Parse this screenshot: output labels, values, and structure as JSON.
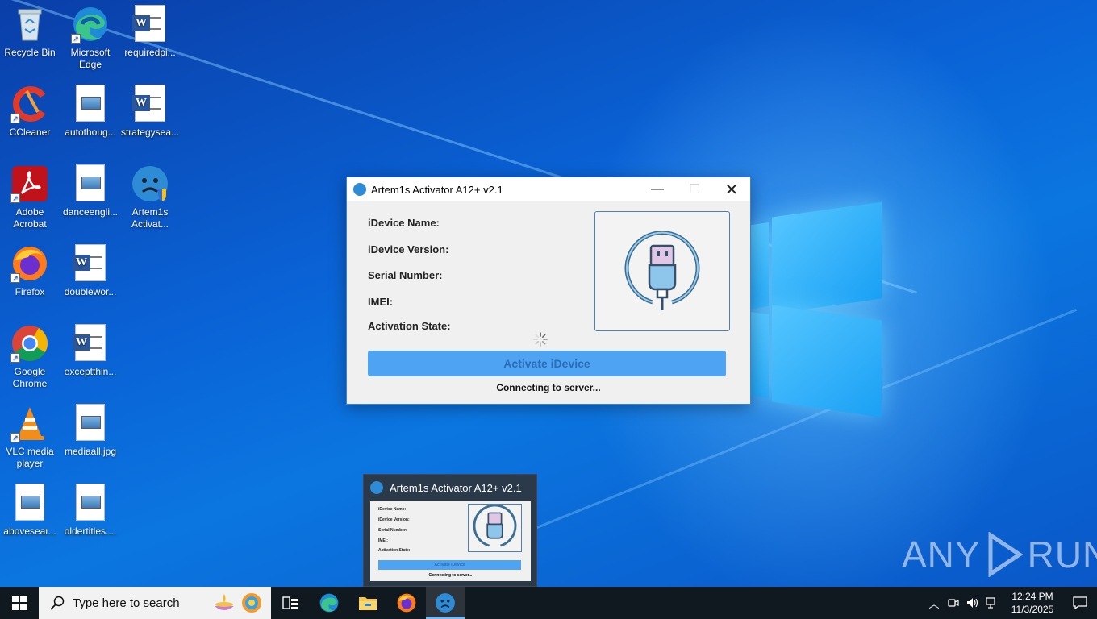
{
  "desktop_icons": [
    {
      "name": "recycle-bin",
      "label": "Recycle Bin"
    },
    {
      "name": "microsoft-edge",
      "label": "Microsoft Edge"
    },
    {
      "name": "requiredpi",
      "label": "requiredpi..."
    },
    {
      "name": "ccleaner",
      "label": "CCleaner"
    },
    {
      "name": "autothoug",
      "label": "autothoug..."
    },
    {
      "name": "strategysea",
      "label": "strategysea..."
    },
    {
      "name": "adobe-acrobat",
      "label": "Adobe Acrobat"
    },
    {
      "name": "danceengli",
      "label": "danceengli..."
    },
    {
      "name": "artem1s-activat",
      "label": "Artem1s Activat..."
    },
    {
      "name": "firefox",
      "label": "Firefox"
    },
    {
      "name": "doublewor",
      "label": "doublewor..."
    },
    {
      "name": "google-chrome",
      "label": "Google Chrome"
    },
    {
      "name": "exceptthin",
      "label": "exceptthin..."
    },
    {
      "name": "vlc-media-player",
      "label": "VLC media player"
    },
    {
      "name": "mediaall",
      "label": "mediaall.jpg"
    },
    {
      "name": "abovesear",
      "label": "abovesear..."
    },
    {
      "name": "oldertitles",
      "label": "oldertitles...."
    }
  ],
  "window": {
    "title": "Artem1s Activator A12+ v2.1",
    "fields": {
      "device_name": "iDevice Name:",
      "device_version": "iDevice Version:",
      "serial_number": "Serial Number:",
      "imei": "IMEI:",
      "activation_state": "Activation State:"
    },
    "activate_label": "Activate iDevice",
    "status": "Connecting to server..."
  },
  "thumbnail": {
    "title": "Artem1s Activator A12+ v2.1"
  },
  "watermark": {
    "left": "ANY",
    "right": "RUN"
  },
  "taskbar": {
    "search_placeholder": "Type here to search",
    "time": "12:24 PM",
    "date": "11/3/2025"
  },
  "colors": {
    "window_border": "#3c7fd4",
    "activate_button": "#4ea3f2",
    "taskbar": "#101820"
  }
}
